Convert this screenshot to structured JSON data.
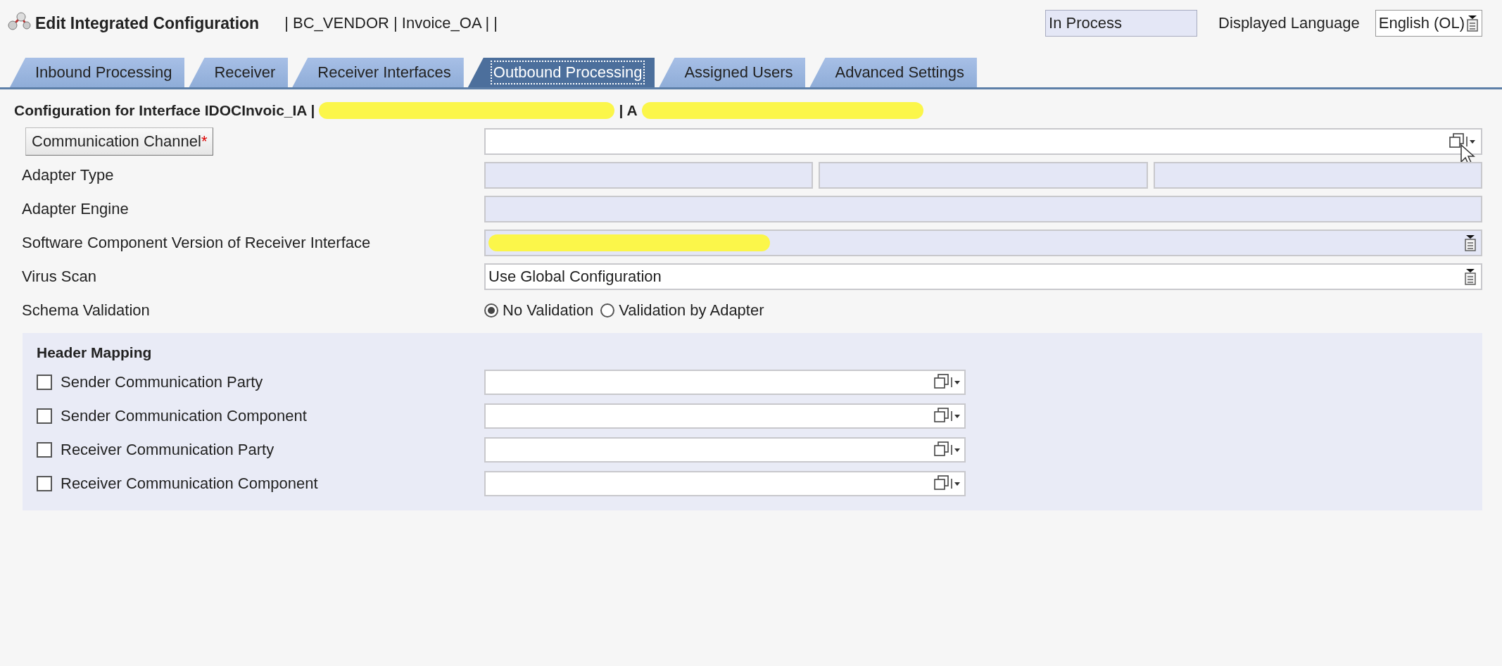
{
  "window": {
    "title": "Edit Integrated Configuration",
    "object_path": "| BC_VENDOR | Invoice_OA |  |"
  },
  "status": {
    "value": "In Process"
  },
  "language": {
    "label": "Displayed Language",
    "value": "English (OL)"
  },
  "tabs": [
    {
      "label": "Inbound Processing",
      "selected": false
    },
    {
      "label": "Receiver",
      "selected": false
    },
    {
      "label": "Receiver Interfaces",
      "selected": false
    },
    {
      "label": "Outbound Processing",
      "selected": true
    },
    {
      "label": "Assigned Users",
      "selected": false
    },
    {
      "label": "Advanced Settings",
      "selected": false
    }
  ],
  "config_heading": {
    "text": "Configuration for Interface IDOCInvoic_IA |",
    "text_2": "| A",
    "redacted": true
  },
  "fields": [
    {
      "kind": "value-help",
      "label": "Communication Channel",
      "required_mark": "*",
      "disabled": false
    },
    {
      "kind": "split",
      "label": "Adapter Type",
      "disabled": true
    },
    {
      "kind": "text",
      "label": "Adapter Engine",
      "disabled": true
    },
    {
      "kind": "dropdown",
      "label": "Software Component Version of Receiver Interface",
      "disabled": true,
      "redacted": true
    },
    {
      "kind": "dropdown",
      "label": "Virus Scan",
      "value": "Use Global Configuration",
      "disabled": false
    },
    {
      "kind": "radio",
      "label": "Schema Validation",
      "options": [
        {
          "label": "No Validation",
          "selected": true
        },
        {
          "label": "Validation by Adapter",
          "selected": false
        }
      ]
    }
  ],
  "header_mapping": {
    "title": "Header Mapping",
    "rows": [
      {
        "label": "Sender Communication Party",
        "checked": false
      },
      {
        "label": "Sender Communication Component",
        "checked": false
      },
      {
        "label": "Receiver Communication Party",
        "checked": false
      },
      {
        "label": "Receiver Communication Component",
        "checked": false
      }
    ]
  }
}
